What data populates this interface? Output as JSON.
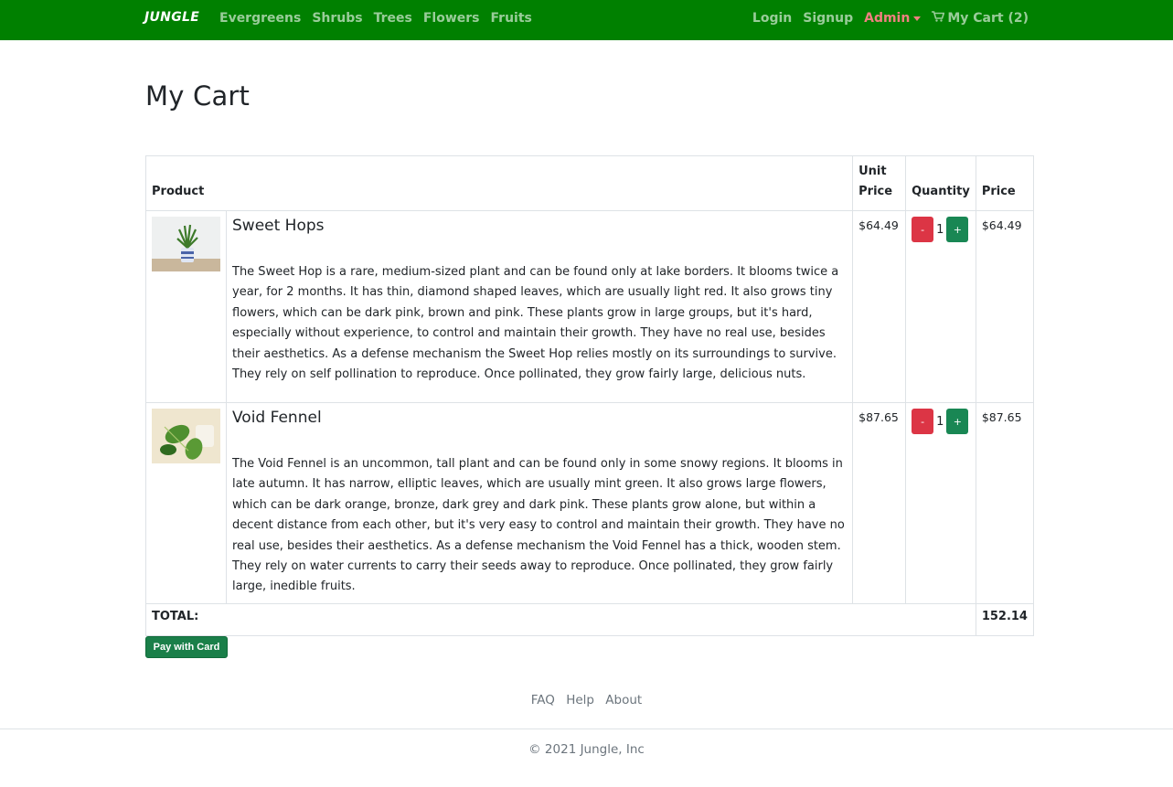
{
  "navbar": {
    "brand": "JUNGLE",
    "categories": [
      "Evergreens",
      "Shrubs",
      "Trees",
      "Flowers",
      "Fruits"
    ],
    "login": "Login",
    "signup": "Signup",
    "admin": "Admin",
    "cart": "My Cart (2)"
  },
  "page": {
    "title": "My Cart"
  },
  "table": {
    "headers": {
      "product": "Product",
      "unit_price": "Unit Price",
      "quantity": "Quantity",
      "price": "Price"
    },
    "items": [
      {
        "name": "Sweet Hops",
        "description": "The Sweet Hop is a rare, medium-sized plant and can be found only at lake borders. It blooms twice a year, for 2 months. It has thin, diamond shaped leaves, which are usually light red. It also grows tiny flowers, which can be dark pink, brown and pink. These plants grow in large groups, but it's hard, especially without experience, to control and maintain their growth. They have no real use, besides their aesthetics. As a defense mechanism the Sweet Hop relies mostly on its surroundings to survive. They rely on self pollination to reproduce. Once pollinated, they grow fairly large, delicious nuts.",
        "unit_price": "$64.49",
        "quantity": "1",
        "price": "$64.49",
        "minus": "-",
        "plus": "+"
      },
      {
        "name": "Void Fennel",
        "description": "The Void Fennel is an uncommon, tall plant and can be found only in some snowy regions. It blooms in late autumn. It has narrow, elliptic leaves, which are usually mint green. It also grows large flowers, which can be dark orange, bronze, dark grey and dark pink. These plants grow alone, but within a decent distance from each other, but it's very easy to control and maintain their growth. They have no real use, besides their aesthetics. As a defense mechanism the Void Fennel has a thick, wooden stem. They rely on water currents to carry their seeds away to reproduce. Once pollinated, they grow fairly large, inedible fruits.",
        "unit_price": "$87.65",
        "quantity": "1",
        "price": "$87.65",
        "minus": "-",
        "plus": "+"
      }
    ],
    "total_label": "TOTAL:",
    "total_value": "152.14"
  },
  "pay_button": "Pay with Card",
  "footer": {
    "links": [
      "FAQ",
      "Help",
      "About"
    ],
    "copyright": "© 2021 Jungle, Inc"
  },
  "colors": {
    "navbar_bg": "#008000",
    "admin_link": "#f08080",
    "minus_button": "#dc3545",
    "plus_button": "#198754",
    "pay_button": "#1a7f49"
  }
}
